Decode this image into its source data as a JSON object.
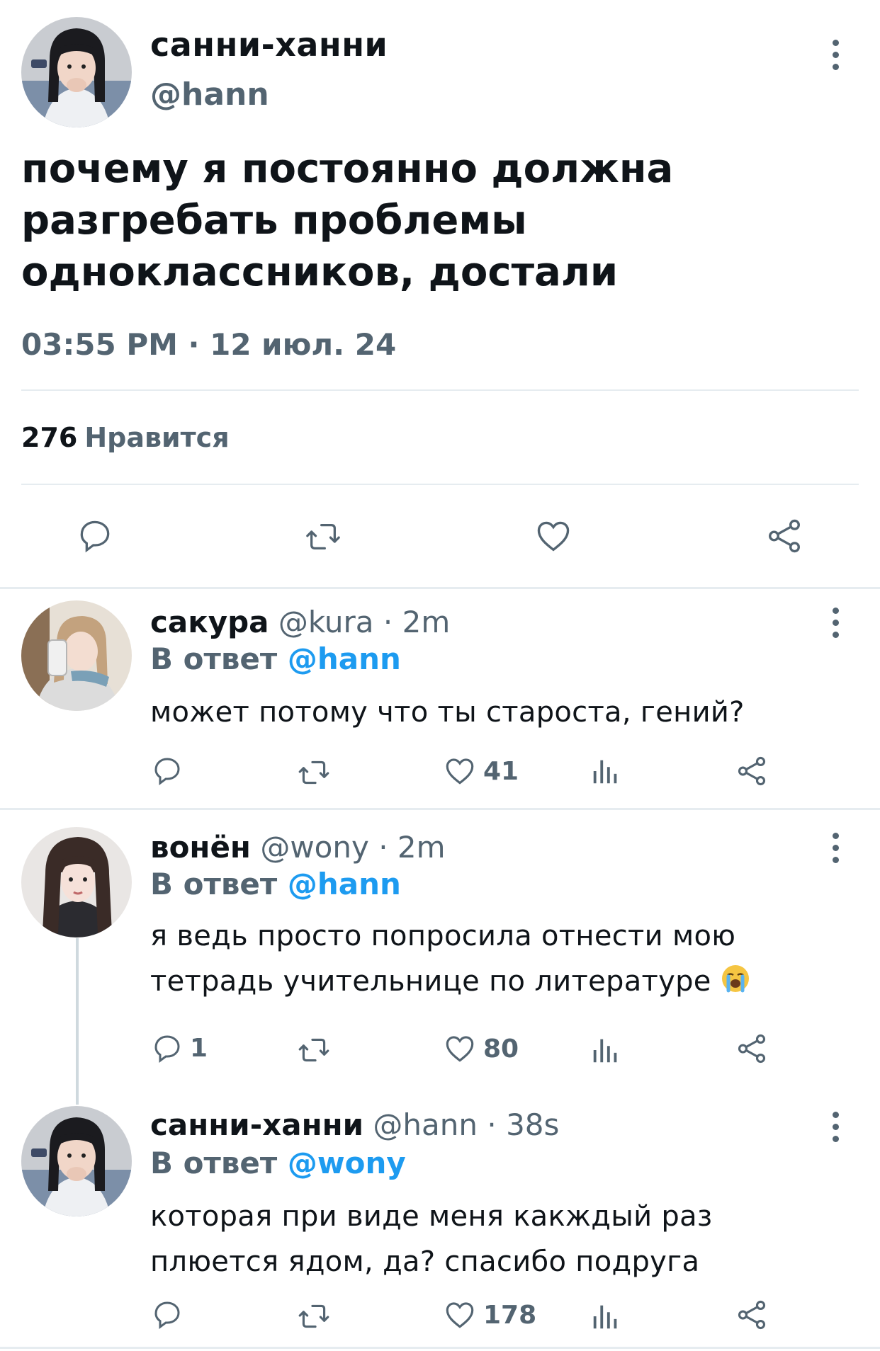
{
  "main_tweet": {
    "display_name": "санни-ханни",
    "handle": "@hann",
    "text": "почему я постоянно должна разгребать проблемы одноклассников, достали",
    "timestamp": "03:55 PM · 12 июл. 24",
    "likes_count": "276",
    "likes_label": "Нравится",
    "icons": [
      "reply-icon",
      "retweet-icon",
      "like-icon",
      "share-icon"
    ]
  },
  "replies": [
    {
      "display_name": "сакура",
      "handle": "@kura",
      "time": "2m",
      "reply_prefix": "В ответ",
      "reply_to": "@hann",
      "text": "может потому что ты староста, гений?",
      "reply_count": "",
      "like_count": "41"
    },
    {
      "display_name": "вонён",
      "handle": "@wony",
      "time": "2m",
      "reply_prefix": "В ответ",
      "reply_to": "@hann",
      "text": "я ведь просто попросила отнести мою тетрадь учительнице по литературе",
      "text_emoji": "loudly-crying-face",
      "reply_count": "1",
      "like_count": "80"
    },
    {
      "display_name": "санни-ханни",
      "handle": "@hann",
      "time": "38s",
      "reply_prefix": "В ответ",
      "reply_to": "@wony",
      "text": "которая при виде меня какждый раз плюется ядом, да? спасибо подруга",
      "reply_count": "",
      "like_count": "178"
    }
  ],
  "colors": {
    "text": "#0f1419",
    "secondary": "#536471",
    "link": "#1d9bf0",
    "divider": "#e6ecf0"
  }
}
